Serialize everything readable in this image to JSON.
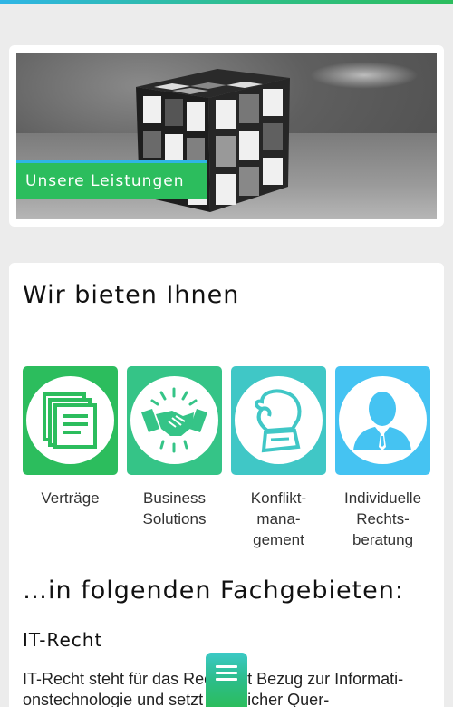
{
  "hero": {
    "label": "Unsere Leistungen"
  },
  "main": {
    "heading": "Wir bieten Ihnen",
    "services": [
      {
        "label": "Verträge",
        "icon": "contract-icon",
        "color": "#2cbd5d"
      },
      {
        "label": "Business Solutions",
        "icon": "handshake-icon",
        "color": "#35c487"
      },
      {
        "label": "Konflikt­management",
        "label_lines": [
          "Konflikt-",
          "mana-",
          "gement"
        ],
        "icon": "boxing-glove-icon",
        "color": "#40c7c6"
      },
      {
        "label": "Individuelle Rechtsberatung",
        "label_lines": [
          "Individuelle",
          "Rechts-",
          "beratung"
        ],
        "icon": "lawyer-icon",
        "color": "#45c3f2"
      }
    ],
    "areas_heading": "…in folgenden Fachgebieten:",
    "area_title": "IT-Recht",
    "area_text": "IT-Recht steht für das Recht mit Bezug zur Informationstechnologie und setzt rechtlicher Quer-"
  },
  "colors": {
    "green": "#2cbd5d",
    "blue": "#2fb5e6"
  }
}
